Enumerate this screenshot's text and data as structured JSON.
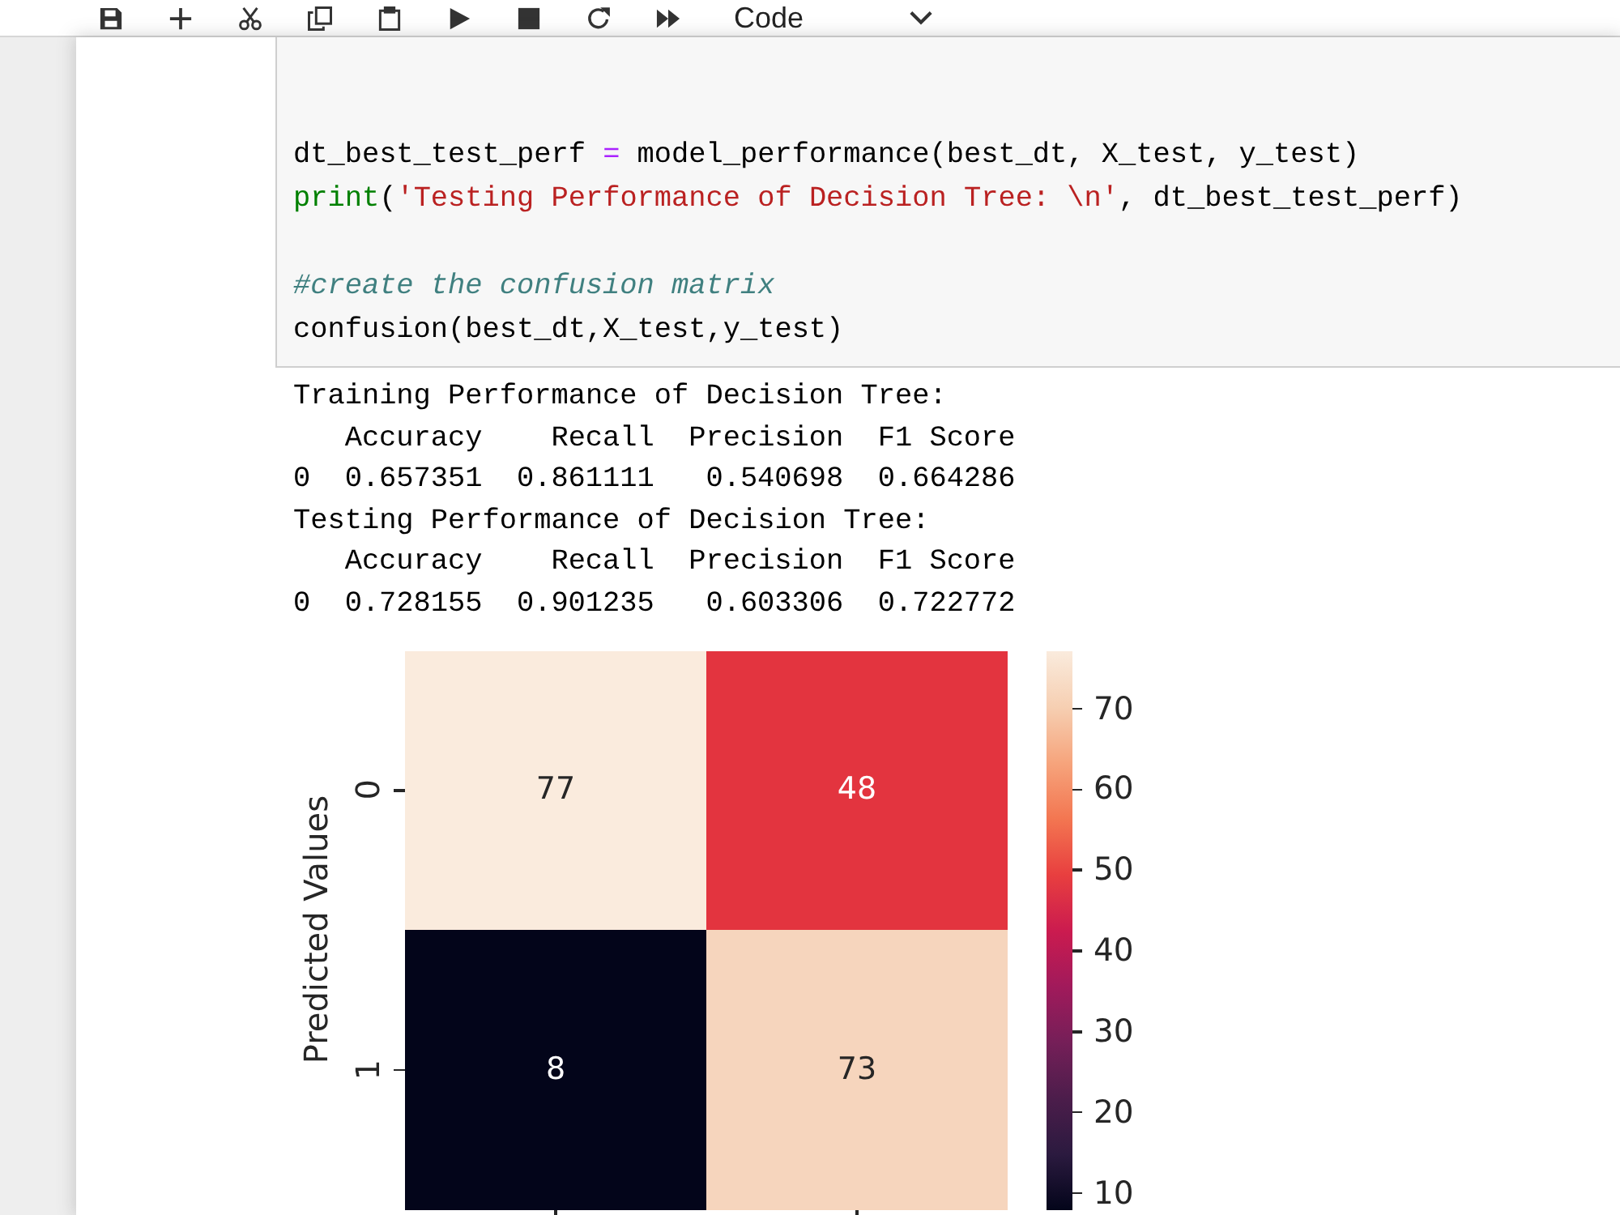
{
  "toolbar": {
    "buttons": [
      {
        "kind": "save"
      },
      {
        "kind": "add"
      },
      {
        "kind": "cut"
      },
      {
        "kind": "copy"
      },
      {
        "kind": "paste"
      },
      {
        "kind": "run"
      },
      {
        "kind": "stop"
      },
      {
        "kind": "restart"
      },
      {
        "kind": "run_all"
      }
    ],
    "cell_type": "Code"
  },
  "code_cell": {
    "blocks": [
      {
        "lines": [
          {
            "tokens": [
              {
                "text": "dt_best_test_perf ",
                "kind": "plain"
              },
              {
                "text": "=",
                "kind": "operator"
              },
              {
                "text": " model_performance(best_dt, X_test, y_test)",
                "kind": "plain"
              }
            ]
          },
          {
            "tokens": [
              {
                "text": "print",
                "kind": "builtin"
              },
              {
                "text": "(",
                "kind": "plain"
              },
              {
                "text": "'Testing Performance of Decision Tree: \\n'",
                "kind": "string"
              },
              {
                "text": ", dt_best_test_perf)",
                "kind": "plain"
              }
            ]
          }
        ]
      },
      {
        "lines": [
          {
            "tokens": [
              {
                "text": "#create the confusion matrix",
                "kind": "comment"
              }
            ]
          },
          {
            "tokens": [
              {
                "text": "confusion(best_dt,X_test,y_test)",
                "kind": "plain"
              }
            ]
          }
        ]
      }
    ]
  },
  "output": {
    "sections": [
      {
        "heading": "Training Performance of Decision Tree:",
        "columns": [
          "Accuracy",
          "Recall",
          "Precision",
          "F1 Score"
        ],
        "rows": [
          {
            "index": "0",
            "values": [
              "0.657351",
              "0.861111",
              "0.540698",
              "0.664286"
            ]
          }
        ]
      },
      {
        "heading": "Testing Performance of Decision Tree:",
        "columns": [
          "Accuracy",
          "Recall",
          "Precision",
          "F1 Score"
        ],
        "rows": [
          {
            "index": "0",
            "values": [
              "0.728155",
              "0.901235",
              "0.603306",
              "0.722772"
            ]
          }
        ]
      }
    ]
  },
  "heatmap": {
    "ylabel": "Predicted Values",
    "row_labels": [
      "0",
      "1"
    ],
    "rows": [
      [
        {
          "value": "77",
          "color": "#faebdd"
        },
        {
          "value": "48",
          "color": "#e3343f"
        }
      ],
      [
        {
          "value": "8",
          "color": "#03051a"
        },
        {
          "value": "73",
          "color": "#f6d5bd"
        }
      ]
    ],
    "colorbar_ticks": [
      "70",
      "60",
      "50",
      "40",
      "30",
      "20",
      "10"
    ]
  }
}
